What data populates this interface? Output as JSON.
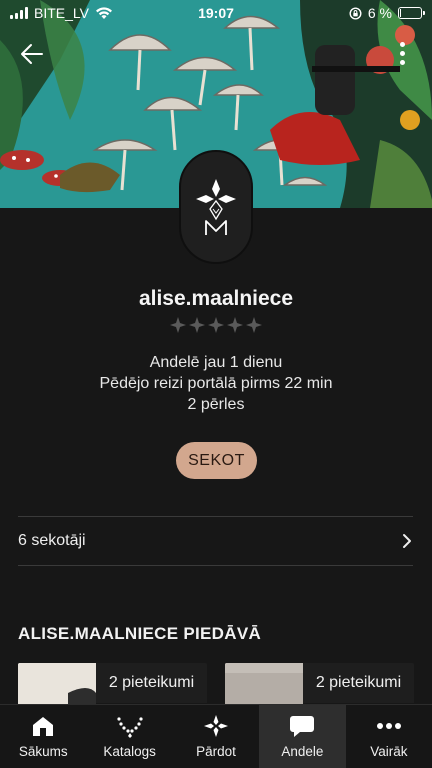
{
  "status_bar": {
    "carrier": "BITE_LV",
    "time": "19:07",
    "battery": "6 %",
    "battery_level": 0.06
  },
  "cover": {
    "icons": {
      "back": "back-arrow-icon",
      "menu": "more-vertical-icon"
    }
  },
  "profile": {
    "username": "alise.maalniece",
    "rating_stars": 0,
    "rating_max": 5,
    "info_lines": [
      "Andelē jau 1 dienu",
      "Pēdējo reizi portālā pirms 22 min",
      "2 pērles"
    ],
    "follow_label": "SEKOT"
  },
  "followers": {
    "label": "6 sekotāji"
  },
  "offers": {
    "title": "ALISE.MAALNIECE PIEDĀVĀ",
    "cards": [
      {
        "label": "2 pieteikumi"
      },
      {
        "label": "2 pieteikumi"
      }
    ]
  },
  "nav": {
    "items": [
      {
        "label": "Sākums",
        "icon": "home-icon"
      },
      {
        "label": "Katalogs",
        "icon": "necklace-icon"
      },
      {
        "label": "Pārdot",
        "icon": "diamond-star-icon"
      },
      {
        "label": "Andele",
        "icon": "chat-bubble-icon"
      },
      {
        "label": "Vairāk",
        "icon": "more-dots-icon"
      }
    ],
    "active_index": 3
  },
  "colors": {
    "background": "#171717",
    "follow_button": "#d2a78e",
    "cover_teal": "#2b9c98"
  }
}
